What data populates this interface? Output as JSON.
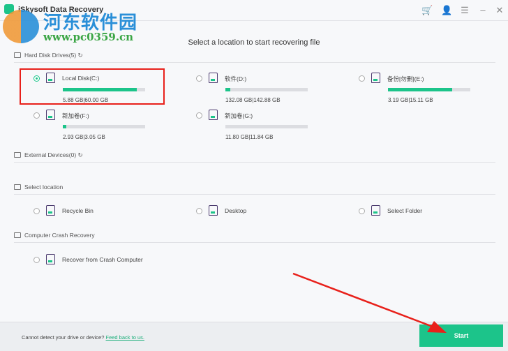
{
  "app": {
    "title": "iSkysoft Data Recovery"
  },
  "watermark": {
    "name": "河东软件园",
    "url": "www.pc0359.cn"
  },
  "heading": "Select a location to start recovering file",
  "sections": {
    "hdd": "Hard Disk Drives(5)",
    "external": "External Devices(0)",
    "location": "Select location",
    "crash": "Computer Crash Recovery"
  },
  "drives": [
    {
      "name": "Local Disk(C:)",
      "size": "5.88  GB|60.00  GB",
      "fill": 0.9,
      "selected": true
    },
    {
      "name": "软件(D:)",
      "size": "132.08  GB|142.88  GB",
      "fill": 0.06,
      "selected": false
    },
    {
      "name": "备份[勿删](E:)",
      "size": "3.19  GB|15.11  GB",
      "fill": 0.78,
      "selected": false
    },
    {
      "name": "新加卷(F:)",
      "size": "2.93  GB|3.05  GB",
      "fill": 0.04,
      "selected": false
    },
    {
      "name": "新加卷(G:)",
      "size": "11.80  GB|11.84  GB",
      "fill": 0.0,
      "selected": false
    }
  ],
  "locations": [
    {
      "name": "Recycle Bin"
    },
    {
      "name": "Desktop"
    },
    {
      "name": "Select Folder"
    }
  ],
  "crash": {
    "name": "Recover from Crash Computer"
  },
  "footer": {
    "text": "Cannot detect your drive or device?",
    "link": "Feed back to us."
  },
  "start": "Start",
  "colors": {
    "accent": "#1cc48a",
    "highlight": "#e8201a"
  }
}
